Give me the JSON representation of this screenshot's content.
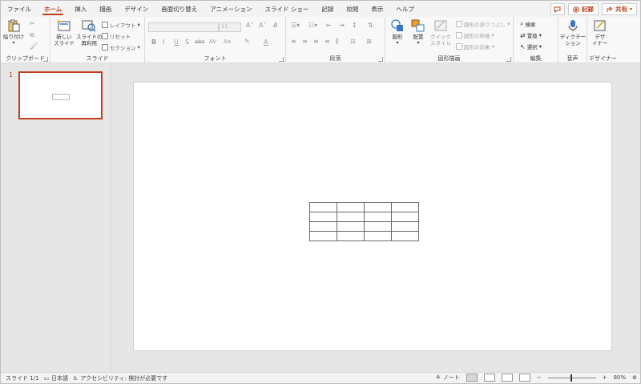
{
  "tabs": [
    {
      "label": "ファイル"
    },
    {
      "label": "ホーム"
    },
    {
      "label": "挿入"
    },
    {
      "label": "描画"
    },
    {
      "label": "デザイン"
    },
    {
      "label": "画面切り替え"
    },
    {
      "label": "アニメーション"
    },
    {
      "label": "スライド ショー"
    },
    {
      "label": "記録"
    },
    {
      "label": "校閲"
    },
    {
      "label": "表示"
    },
    {
      "label": "ヘルプ"
    }
  ],
  "active_tab": "ホーム",
  "tabbar_right": {
    "record_label": "記録",
    "share_label": "共有"
  },
  "ribbon": {
    "clipboard": {
      "label": "クリップボード",
      "paste": "貼り付け"
    },
    "slides": {
      "label": "スライド",
      "new_slide_1": "新しい",
      "new_slide_2": "スライド",
      "reuse_1": "スライドの",
      "reuse_2": "再利用",
      "layout": "レイアウト",
      "reset": "リセット",
      "section": "セクション"
    },
    "font": {
      "label": "フォント",
      "font_size": "11",
      "bold": "B",
      "italic": "I",
      "underline": "U",
      "shadow": "S",
      "strike": "abc",
      "spacing": "AV",
      "case": "Aa",
      "color": "A"
    },
    "paragraph": {
      "label": "段落"
    },
    "drawing": {
      "label": "図形描画",
      "shapes": "図形",
      "arrange": "配置",
      "quick_1": "クイック",
      "quick_2": "スタイル",
      "fill": "図形の塗りつぶし",
      "outline": "図形の枠線",
      "effects": "図形の効果"
    },
    "editing": {
      "label": "編集",
      "find": "検索",
      "replace": "置換",
      "select": "選択"
    },
    "voice": {
      "label": "音声",
      "dictate_1": "ディクテー",
      "dictate_2": "ション"
    },
    "designer": {
      "label": "デザイナー",
      "designer_1": "デザ",
      "designer_2": "イナー"
    }
  },
  "thumbnails": [
    {
      "number": "1"
    }
  ],
  "slide_table": {
    "rows": 4,
    "cols": 4
  },
  "status": {
    "slide_count": "スライド 1/1",
    "language": "日本語",
    "accessibility": "アクセシビリティ: 検討が必要です",
    "notes": "ノート",
    "zoom": "80%"
  },
  "colors": {
    "accent": "#c43e1c",
    "ribbon_bg": "#f8f8f8",
    "workspace_bg": "#e6e6e6"
  }
}
